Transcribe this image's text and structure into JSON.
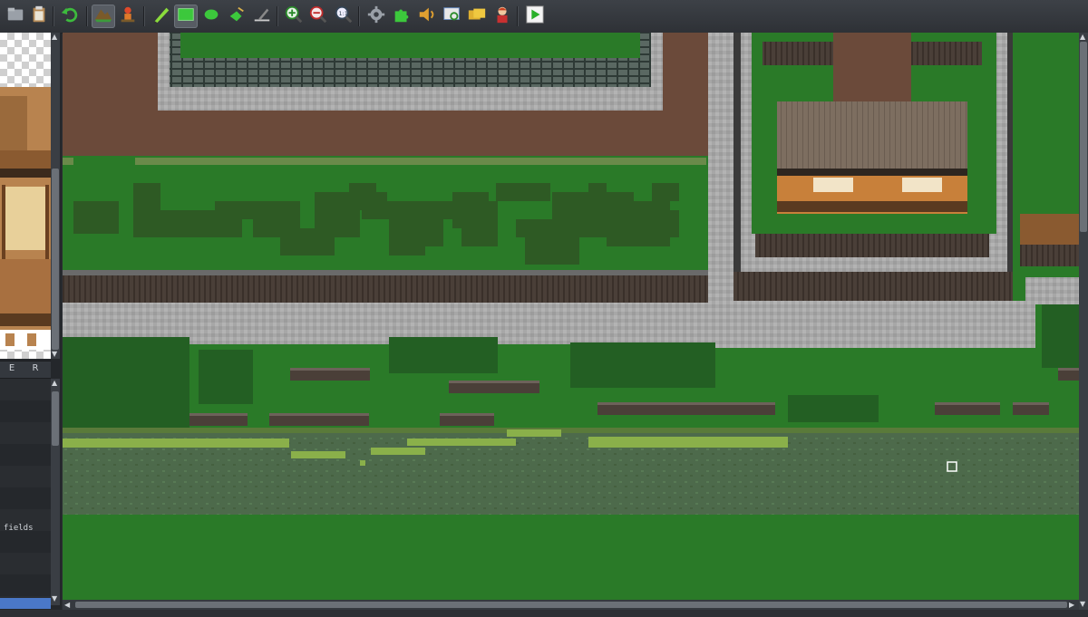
{
  "toolbar": {
    "buttons": [
      {
        "name": "new-project-button",
        "icon": "folder-icon",
        "active": false
      },
      {
        "name": "open-project-button",
        "icon": "clipboard-icon",
        "active": false
      },
      {
        "name": "undo-button",
        "icon": "undo-icon",
        "active": false
      },
      {
        "name": "map-layer-button",
        "icon": "map-layer-icon",
        "active": true
      },
      {
        "name": "event-layer-button",
        "icon": "event-layer-icon",
        "active": false
      },
      {
        "name": "pencil-tool-button",
        "icon": "pencil-icon",
        "active": false
      },
      {
        "name": "rectangle-tool-button",
        "icon": "rectangle-icon",
        "active": true
      },
      {
        "name": "ellipse-tool-button",
        "icon": "ellipse-icon",
        "active": false
      },
      {
        "name": "flood-fill-tool-button",
        "icon": "paint-bucket-icon",
        "active": false
      },
      {
        "name": "shadow-pen-tool-button",
        "icon": "shadow-pen-icon",
        "active": false
      },
      {
        "name": "zoom-in-button",
        "icon": "zoom-in-icon",
        "active": false
      },
      {
        "name": "zoom-out-button",
        "icon": "zoom-out-icon",
        "active": false
      },
      {
        "name": "actual-size-button",
        "icon": "zoom-actual-icon",
        "active": false
      },
      {
        "name": "database-button",
        "icon": "gear-icon",
        "active": false
      },
      {
        "name": "plugin-manager-button",
        "icon": "puzzle-icon",
        "active": false
      },
      {
        "name": "sound-test-button",
        "icon": "speaker-icon",
        "active": false
      },
      {
        "name": "event-search-button",
        "icon": "search-window-icon",
        "active": false
      },
      {
        "name": "resource-manager-button",
        "icon": "folders-icon",
        "active": false
      },
      {
        "name": "character-generator-button",
        "icon": "character-icon",
        "active": false
      },
      {
        "name": "playtest-button",
        "icon": "play-icon",
        "active": false
      }
    ]
  },
  "tile_palette": {
    "tabs": [
      "E",
      "R"
    ]
  },
  "map_list": {
    "items": [
      "fields"
    ]
  },
  "colors": {
    "grass": "#2a7a28",
    "grass_dark": "#235f23",
    "bush": "#2e5a24",
    "dirt": "#6b4a3a",
    "stone": "#a9a9a9",
    "wall_wood": "#4a3f38",
    "water": "#4d6a4b",
    "moss": "#8ab04a",
    "roof": "#7d6e60",
    "selection": "#4a78c8"
  }
}
